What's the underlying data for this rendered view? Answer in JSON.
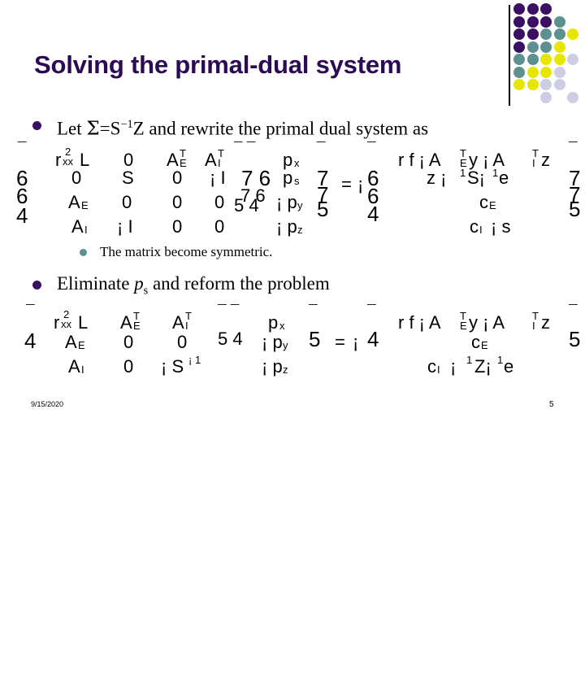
{
  "slide": {
    "title": "Solving the primal-dual system",
    "title_color": "#2d0a54",
    "background": "#ffffff"
  },
  "decor": {
    "name": "dot-grid",
    "colors": {
      "purple": "#3b0f63",
      "teal": "#5d9090",
      "yellow": "#e6e600",
      "lavender": "#cdcde4"
    },
    "dots": [
      {
        "row": 0,
        "col": 0,
        "color": "#3b0f63"
      },
      {
        "row": 0,
        "col": 1,
        "color": "#3b0f63"
      },
      {
        "row": 0,
        "col": 2,
        "color": "#3b0f63"
      },
      {
        "row": 1,
        "col": 0,
        "color": "#3b0f63"
      },
      {
        "row": 1,
        "col": 1,
        "color": "#3b0f63"
      },
      {
        "row": 1,
        "col": 2,
        "color": "#3b0f63"
      },
      {
        "row": 1,
        "col": 3,
        "color": "#5d9090"
      },
      {
        "row": 2,
        "col": 0,
        "color": "#3b0f63"
      },
      {
        "row": 2,
        "col": 1,
        "color": "#3b0f63"
      },
      {
        "row": 2,
        "col": 2,
        "color": "#5d9090"
      },
      {
        "row": 2,
        "col": 3,
        "color": "#5d9090"
      },
      {
        "row": 2,
        "col": 4,
        "color": "#e6e600"
      },
      {
        "row": 3,
        "col": 0,
        "color": "#3b0f63"
      },
      {
        "row": 3,
        "col": 1,
        "color": "#5d9090"
      },
      {
        "row": 3,
        "col": 2,
        "color": "#5d9090"
      },
      {
        "row": 3,
        "col": 3,
        "color": "#e6e600"
      },
      {
        "row": 4,
        "col": 0,
        "color": "#5d9090"
      },
      {
        "row": 4,
        "col": 1,
        "color": "#5d9090"
      },
      {
        "row": 4,
        "col": 2,
        "color": "#e6e600"
      },
      {
        "row": 4,
        "col": 3,
        "color": "#e6e600"
      },
      {
        "row": 4,
        "col": 4,
        "color": "#cdcde4"
      },
      {
        "row": 5,
        "col": 0,
        "color": "#5d9090"
      },
      {
        "row": 5,
        "col": 1,
        "color": "#e6e600"
      },
      {
        "row": 5,
        "col": 2,
        "color": "#e6e600"
      },
      {
        "row": 5,
        "col": 3,
        "color": "#cdcde4"
      },
      {
        "row": 6,
        "col": 0,
        "color": "#e6e600"
      },
      {
        "row": 6,
        "col": 1,
        "color": "#e6e600"
      },
      {
        "row": 6,
        "col": 2,
        "color": "#cdcde4"
      },
      {
        "row": 6,
        "col": 3,
        "color": "#cdcde4"
      },
      {
        "row": 7,
        "col": 2,
        "color": "#cdcde4"
      },
      {
        "row": 7,
        "col": 4,
        "color": "#cdcde4"
      }
    ]
  },
  "content": {
    "bullet1": {
      "marker": "filled-circle",
      "marker_color": "#3b0f63",
      "text_prefix": "Let ",
      "sigma": "Σ",
      "text_eq": "=S",
      "exp": "−1",
      "text_z": "Z",
      "text_suffix": " and rewrite the primal dual system as"
    },
    "subbullet1": {
      "marker": "filled-circle",
      "marker_color": "#5d9090",
      "text": "The matrix become symmetric."
    },
    "bullet2": {
      "marker": "filled-circle",
      "marker_color": "#3b0f63",
      "text_prefix": "Eliminate ",
      "var_p": "p",
      "var_sub": "s",
      "text_suffix": " and reform the problem"
    }
  },
  "equation1": {
    "note": "garbled symbol-font matrix equation, 4 rows",
    "rows": [
      {
        "c0": "¯",
        "c1": "r",
        "c1sup": "2",
        "c1sub": "xx",
        "c1b": "L",
        "c2": "0",
        "c3": "A",
        "c3sup": "T",
        "c3sub": "E",
        "c4": "A",
        "c4sup": "T",
        "c4sub": "I",
        "c5": "¯ ¯",
        "c6": "p",
        "c6sub": "x",
        "c7": "¯",
        "c8": "¯",
        "c9": "r f ¡ A",
        "c9sup": "T",
        "c9sub": "E",
        "c9b": "y ¡ A",
        "c9c": "T",
        "c9d": "I",
        "c9e": "z",
        "c10": "¯"
      },
      {
        "c0": "6",
        "c1": "0",
        "c2": "S",
        "c3": "0",
        "c4": "¡ I",
        "c5": "7 6",
        "c6": "p",
        "c6sub": "s",
        "c7": "7",
        "c8": "6",
        "c9": "z ¡",
        "c9sup": "1",
        "c9b": "S¡",
        "c9c": "1",
        "c9d": "e",
        "c10": "7"
      },
      {
        "c0": "6",
        "c1": "A",
        "c1sub": "E",
        "c2": "0",
        "c3": "0",
        "c4": "0",
        "c5": "7 6",
        "c6": "¡ p",
        "c6sub": "y",
        "c7": "7",
        "c8": "6",
        "c9": "c",
        "c9sub": "E",
        "c10": "7"
      },
      {
        "c0": "4",
        "c1": "A",
        "c1sub": "I",
        "c2": "¡ I",
        "c3": "0",
        "c4": "0",
        "c5": "5 4",
        "c6": "¡ p",
        "c6sub": "z",
        "c7": "5",
        "c8": "4",
        "c9": "c",
        "c9sub": "I",
        "c9b": "¡ s",
        "c10": "5"
      }
    ],
    "equals": "=",
    "neg": "¡"
  },
  "equation2": {
    "note": "garbled symbol-font matrix equation, 3 rows",
    "rows": [
      {
        "c0": "¯",
        "c1": "r",
        "c1sup": "2",
        "c1sub": "xx",
        "c1b": "L",
        "c2": "A",
        "c2sup": "T",
        "c2sub": "E",
        "c3": "A",
        "c3sup": "T",
        "c3sub": "I",
        "c4": "¯ ¯",
        "c5": "p",
        "c5sub": "x",
        "c6": "¯",
        "c7": "¯",
        "c8": "r f ¡ A",
        "c8sup": "T",
        "c8sub": "E",
        "c8b": "y ¡ A",
        "c8c": "T",
        "c8d": "I",
        "c8e": "z",
        "c9": "¯"
      },
      {
        "c0": "4",
        "c1": "A",
        "c1sub": "E",
        "c2": "0",
        "c3": "0",
        "c4": "5 4",
        "c5": "¡ p",
        "c5sub": "y",
        "c6": "5",
        "c7": "4",
        "c8": "c",
        "c8sub": "E",
        "c9": "5"
      },
      {
        "c0": "",
        "c1": "A",
        "c1sub": "I",
        "c2": "0",
        "c3": "¡ S",
        "c3sup": "¡ 1",
        "c4": "",
        "c5": "¡ p",
        "c5sub": "z",
        "c6": "",
        "c7": "",
        "c8": "c",
        "c8sub": "I",
        "c8b": "¡",
        "c8c": "1",
        "c8d": "Z¡",
        "c8e": "1",
        "c8f": "e",
        "c9": ""
      }
    ],
    "equals": "=",
    "neg": "¡"
  },
  "footer": {
    "date": "9/15/2020",
    "page_number": "5"
  }
}
